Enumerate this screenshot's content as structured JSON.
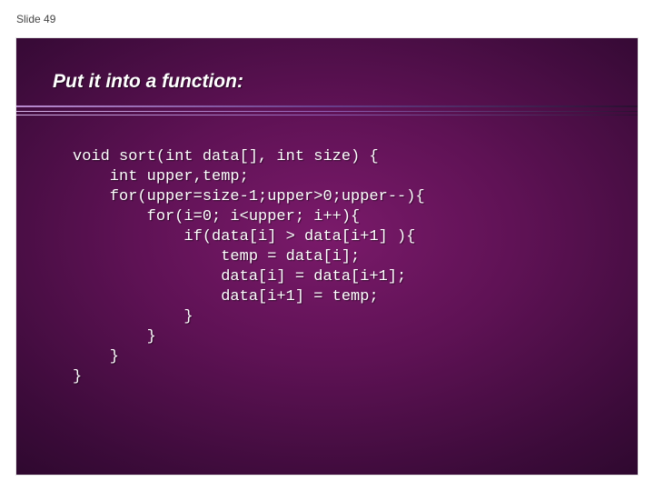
{
  "meta": {
    "slide_label": "Slide 49"
  },
  "slide": {
    "title": "Put it into a function:",
    "code": "void sort(int data[], int size) {\n    int upper,temp;\n    for(upper=size-1;upper>0;upper--){\n        for(i=0; i<upper; i++){\n            if(data[i] > data[i+1] ){\n                temp = data[i];\n                data[i] = data[i+1];\n                data[i+1] = temp;\n            }\n        }\n    }\n}"
  }
}
